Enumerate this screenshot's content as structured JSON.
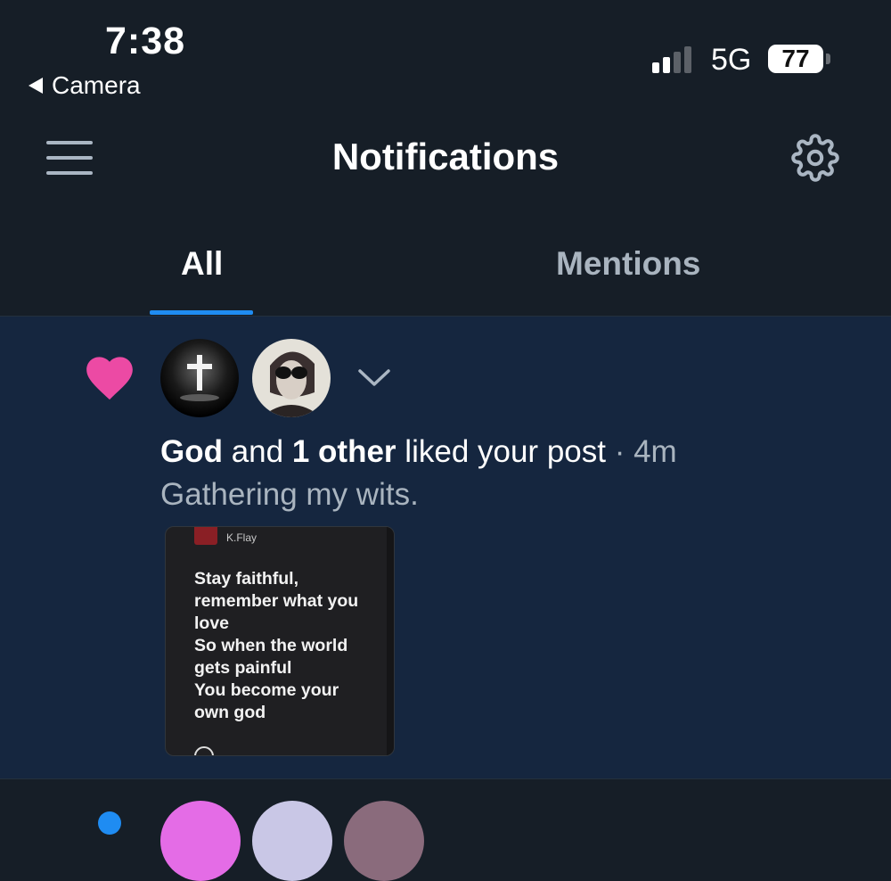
{
  "status_bar": {
    "time": "7:38",
    "back_label": "Camera",
    "network": "5G",
    "battery": "77"
  },
  "header": {
    "title": "Notifications",
    "menu_icon": "hamburger-menu-icon",
    "settings_icon": "gear-icon"
  },
  "tabs": [
    {
      "label": "All",
      "active": true
    },
    {
      "label": "Mentions",
      "active": false
    }
  ],
  "notifications": [
    {
      "type_icon": "heart-icon",
      "actor": "God",
      "connector": "and",
      "others": "1 other",
      "action": "liked your post",
      "time": "· 4m",
      "post_text": "Gathering my wits.",
      "thumbnail": {
        "artist": "K.Flay",
        "lyrics": "Stay faithful,\nremember what you\nlove\nSo when the world\ngets painful\nYou become your\nown god"
      }
    }
  ],
  "colors": {
    "background": "#161e27",
    "card_background": "#15263f",
    "accent": "#1f8cf2",
    "heart": "#ec4aa4",
    "muted_text": "#a9b4bf"
  }
}
